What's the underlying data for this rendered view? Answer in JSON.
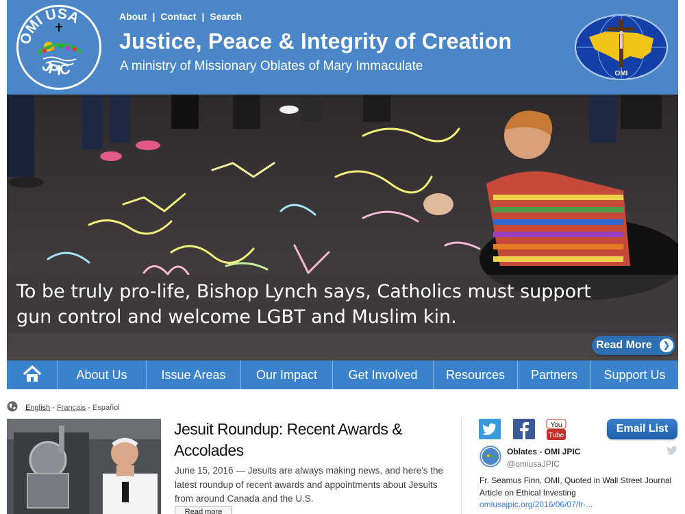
{
  "header": {
    "logo_left_text": "OMI USA JPIC",
    "top_links": [
      "About",
      "Contact",
      "Search"
    ],
    "title": "Justice, Peace & Integrity of Creation",
    "subtitle": "A ministry of Missionary Oblates of Mary Immaculate",
    "logo_right_text": "OMI"
  },
  "hero": {
    "caption_line1": "To be truly pro-life, Bishop Lynch says, Catholics must support",
    "caption_line2": "gun control and welcome LGBT and Muslim kin.",
    "read_more_label": "Read More"
  },
  "nav": {
    "items": [
      "About Us",
      "Issue Areas",
      "Our Impact",
      "Get Involved",
      "Resources",
      "Partners",
      "Support Us"
    ]
  },
  "language": {
    "english": "English",
    "french": "Français",
    "spanish": "Español"
  },
  "article": {
    "title": "Jesuit Roundup: Recent Awards & Accolades",
    "excerpt": "June 15, 2016 — Jesuits are always making news, and here's the latest roundup of recent awards and appointments about Jesuits from around Canada and the U.S.",
    "read_more_label": "Read more"
  },
  "sidebar": {
    "email_list_label": "Email List",
    "youtube_label_top": "You",
    "youtube_label_bottom": "Tube",
    "tweet": {
      "name": "Oblates - OMI JPIC",
      "handle": "@omiusaJPIC",
      "text": "Fr. Seamus Finn, OMI, Quoted in Wall Street Journal Article on Ethical Investing",
      "link": "omiusajpic.org/2016/06/07/fr-..."
    }
  },
  "colors": {
    "header_blue": "#4a86c8",
    "nav_blue": "#3b82cc",
    "button_blue": "#2d6fb3"
  }
}
